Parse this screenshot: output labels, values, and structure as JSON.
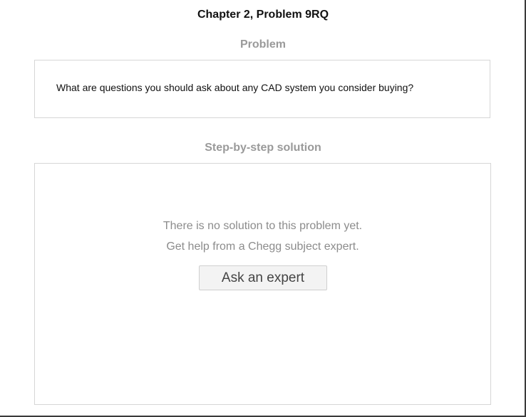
{
  "header": {
    "chapter_title": "Chapter 2, Problem 9RQ"
  },
  "problem": {
    "heading": "Problem",
    "text": "What are questions you should ask about any CAD system you consider buying?"
  },
  "solution": {
    "heading": "Step-by-step solution",
    "empty_line_1": "There is no solution to this problem yet.",
    "empty_line_2": "Get help from a Chegg subject expert.",
    "ask_button_label": "Ask an expert"
  },
  "colors": {
    "title_text": "#111111",
    "section_heading": "#9a9a9a",
    "muted_text": "#8c8c8c",
    "box_border": "#d6d6d6",
    "button_bg": "#f3f3f3"
  }
}
